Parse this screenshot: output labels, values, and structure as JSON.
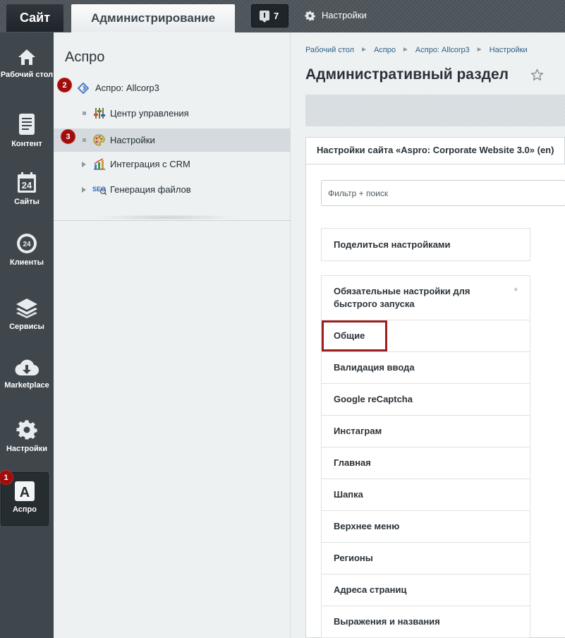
{
  "topbar": {
    "site_tab": "Сайт",
    "admin_tab": "Администрирование",
    "notifications_count": "7",
    "settings_label": "Настройки"
  },
  "left_menu": [
    {
      "label": "Рабочий стол",
      "icon": "home-icon"
    },
    {
      "label": "Контент",
      "icon": "document-icon"
    },
    {
      "label": "Сайты",
      "icon": "calendar-24-icon"
    },
    {
      "label": "Клиенты",
      "icon": "cloud-24-icon"
    },
    {
      "label": "Сервисы",
      "icon": "layers-icon"
    },
    {
      "label": "Marketplace",
      "icon": "cloud-download-icon"
    },
    {
      "label": "Настройки",
      "icon": "gear-icon"
    },
    {
      "label": "Аспро",
      "icon": "aspro-a-icon"
    }
  ],
  "badges": {
    "one": "1",
    "two": "2",
    "three": "3"
  },
  "tree": {
    "title": "Аспро",
    "items": [
      {
        "label": "Аспро: Allcorp3",
        "icon": "aspro-diamond-icon"
      },
      {
        "label": "Центр управления",
        "icon": "control-sliders-icon"
      },
      {
        "label": "Настройки",
        "icon": "palette-icon"
      },
      {
        "label": "Интеграция с CRM",
        "icon": "chart-icon"
      },
      {
        "label": "Генерация файлов",
        "icon": "seo-icon"
      }
    ]
  },
  "main": {
    "breadcrumb": [
      "Рабочий стол",
      "Аспро",
      "Аспро: Allcorp3",
      "Настройки"
    ],
    "breadcrumb_sep": "►",
    "title": "Административный раздел",
    "settings_tab": "Настройки сайта «Aspro: Corporate Website 3.0» (en)",
    "filter_placeholder": "Фильтр + поиск",
    "share_label": "Поделиться настройками",
    "required_label": "Обязательные настройки для быстрого запуска",
    "required_mark": "*",
    "sections": [
      "Общие",
      "Валидация ввода",
      "Google reCaptcha",
      "Инстаграм",
      "Главная",
      "Шапка",
      "Верхнее меню",
      "Регионы",
      "Адреса страниц",
      "Выражения и названия"
    ]
  },
  "colors": {
    "badge": "#9e0e0e",
    "highlight_frame": "#9e1e1e",
    "link": "#2e5f85"
  }
}
